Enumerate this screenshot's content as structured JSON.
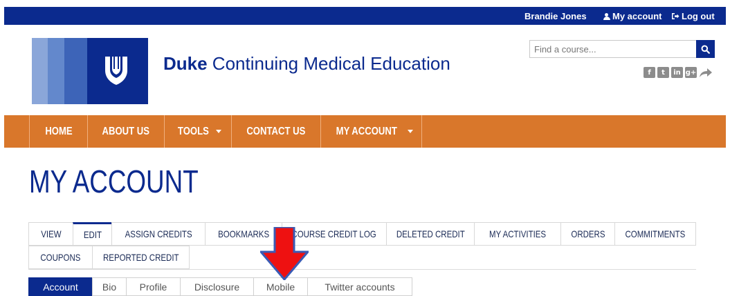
{
  "topbar": {
    "user_name": "Brandie Jones",
    "my_account": "My account",
    "logout": "Log out"
  },
  "brand": {
    "name_bold": "Duke",
    "name_rest": " Continuing Medical Education"
  },
  "search": {
    "placeholder": "Find a course..."
  },
  "social": [
    "facebook-icon",
    "twitter-icon",
    "linkedin-icon",
    "google-plus-icon",
    "share-icon"
  ],
  "nav": {
    "items": [
      {
        "label": "HOME"
      },
      {
        "label": "ABOUT US"
      },
      {
        "label": "TOOLS"
      },
      {
        "label": "CONTACT US"
      },
      {
        "label": "MY ACCOUNT"
      }
    ]
  },
  "page": {
    "title": "MY ACCOUNT"
  },
  "tabs": {
    "items": [
      {
        "label": "VIEW"
      },
      {
        "label": "EDIT"
      },
      {
        "label": "ASSIGN CREDITS"
      },
      {
        "label": "BOOKMARKS"
      },
      {
        "label": "COURSE CREDIT LOG"
      },
      {
        "label": "DELETED CREDIT"
      },
      {
        "label": "MY ACTIVITIES"
      },
      {
        "label": "ORDERS"
      },
      {
        "label": "COMMITMENTS"
      },
      {
        "label": "COUPONS"
      },
      {
        "label": "REPORTED CREDIT"
      }
    ],
    "active_index": 1
  },
  "subtabs": {
    "items": [
      {
        "label": "Account"
      },
      {
        "label": "Bio"
      },
      {
        "label": "Profile"
      },
      {
        "label": "Disclosure"
      },
      {
        "label": "Mobile"
      },
      {
        "label": "Twitter accounts"
      }
    ],
    "active_index": 0
  },
  "colors": {
    "brand_blue": "#0b2a8e",
    "nav_orange": "#d9772b",
    "arrow_red": "#ee1111"
  }
}
